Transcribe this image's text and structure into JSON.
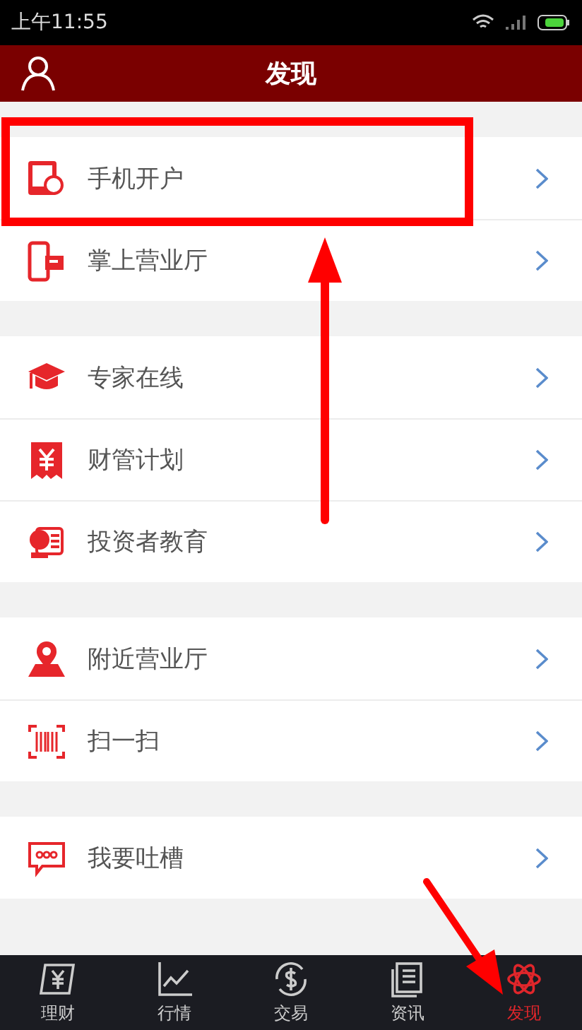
{
  "status_bar": {
    "time": "上午11:55"
  },
  "header": {
    "title": "发现"
  },
  "groups": [
    {
      "items": [
        {
          "label": "手机开户",
          "kind": "tablet"
        },
        {
          "label": "掌上营业厅",
          "kind": "phone"
        }
      ]
    },
    {
      "items": [
        {
          "label": "专家在线",
          "kind": "cap"
        },
        {
          "label": "财管计划",
          "kind": "yen"
        },
        {
          "label": "投资者教育",
          "kind": "scroll"
        }
      ]
    },
    {
      "items": [
        {
          "label": "附近营业厅",
          "kind": "pin"
        },
        {
          "label": "扫一扫",
          "kind": "scan"
        }
      ]
    },
    {
      "items": [
        {
          "label": "我要吐槽",
          "kind": "chat"
        }
      ]
    }
  ],
  "tabs": [
    {
      "label": "理财",
      "kind": "yen",
      "selected": false
    },
    {
      "label": "行情",
      "kind": "chart",
      "selected": false
    },
    {
      "label": "交易",
      "kind": "dollar",
      "selected": false
    },
    {
      "label": "资讯",
      "kind": "news",
      "selected": false
    },
    {
      "label": "发现",
      "kind": "atom",
      "selected": true
    }
  ],
  "annotations": [
    {
      "kind": "frame"
    },
    {
      "kind": "arrow"
    },
    {
      "kind": "arrow"
    }
  ]
}
